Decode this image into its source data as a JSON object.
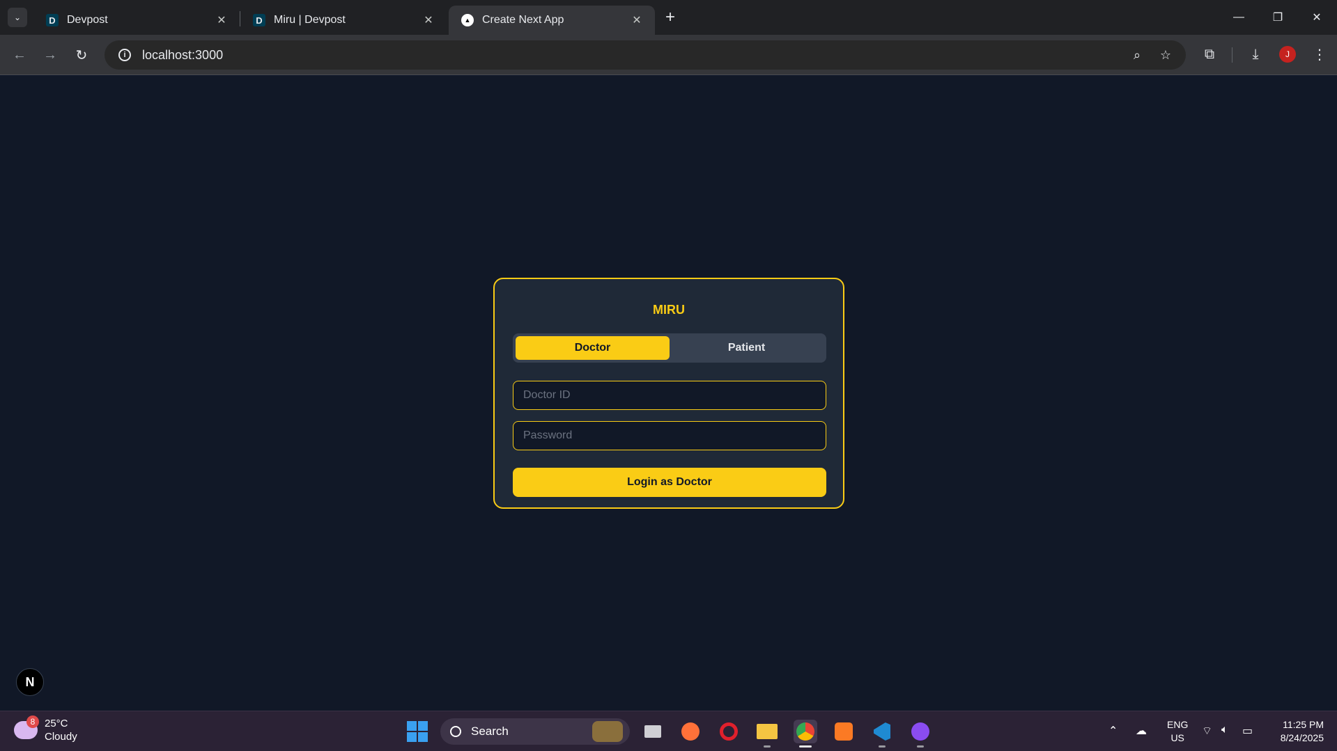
{
  "browser": {
    "tabs": [
      {
        "title": "Devpost",
        "favicon": "D"
      },
      {
        "title": "Miru | Devpost",
        "favicon": "D"
      },
      {
        "title": "Create Next App",
        "favicon": "▲"
      }
    ],
    "url": "localhost:3000",
    "profile_initial": "J"
  },
  "login": {
    "brand": "MIRU",
    "roles": {
      "doctor": "Doctor",
      "patient": "Patient"
    },
    "selected_role": "Doctor",
    "id_placeholder": "Doctor ID",
    "password_placeholder": "Password",
    "submit_label": "Login as Doctor",
    "accent_color": "#facc15"
  },
  "nextjs_badge": "N",
  "taskbar": {
    "weather_temp": "25°C",
    "weather_desc": "Cloudy",
    "weather_badge": "8",
    "search_label": "Search",
    "lang_1": "ENG",
    "lang_2": "US",
    "time": "11:25 PM",
    "date": "8/24/2025"
  }
}
